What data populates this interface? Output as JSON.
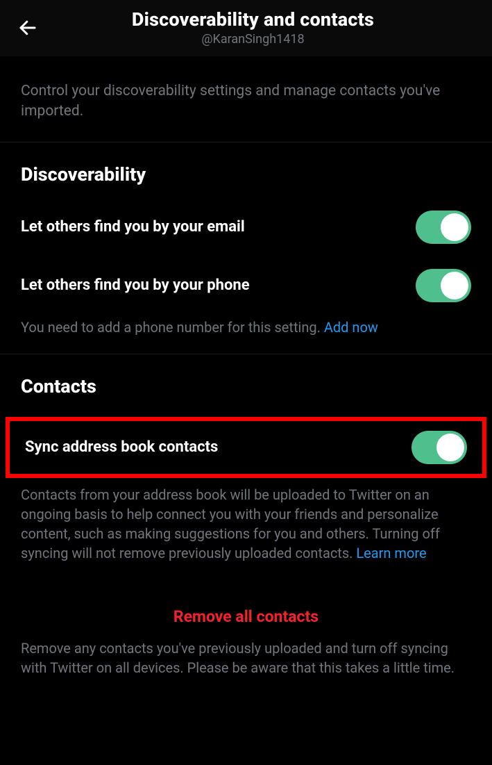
{
  "header": {
    "title": "Discoverability and contacts",
    "handle": "@KaranSingh1418"
  },
  "intro": "Control your discoverability settings and manage contacts you've imported.",
  "discoverability": {
    "title": "Discoverability",
    "email_row": "Let others find you by your email",
    "phone_row": "Let others find you by your phone",
    "phone_note_prefix": "You need to add a phone number for this setting. ",
    "phone_note_link": "Add now"
  },
  "contacts": {
    "title": "Contacts",
    "sync_row": "Sync address book contacts",
    "sync_desc_prefix": "Contacts from your address book will be uploaded to Twitter on an ongoing basis to help connect you with your friends and personalize content, such as making suggestions for you and others. Turning off syncing will not remove previously uploaded contacts. ",
    "sync_desc_link": "Learn more",
    "remove_label": "Remove all contacts",
    "remove_desc": "Remove any contacts you've previously uploaded and turn off syncing with Twitter on all devices. Please be aware that this takes a little time."
  },
  "toggles": {
    "email": true,
    "phone": true,
    "sync": true
  }
}
